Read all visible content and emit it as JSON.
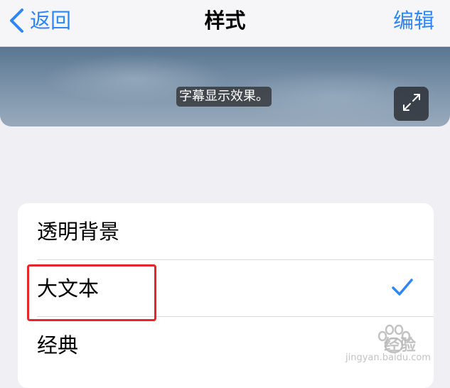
{
  "nav": {
    "back_label": "返回",
    "title": "样式",
    "edit_label": "编辑"
  },
  "preview": {
    "caption": "字幕显示效果。"
  },
  "styles": [
    {
      "label": "透明背景",
      "selected": false
    },
    {
      "label": "大文本",
      "selected": true
    },
    {
      "label": "经典",
      "selected": false
    }
  ],
  "watermark": {
    "text": "经验",
    "url": "jingyan.baidu.com"
  },
  "colors": {
    "accent": "#2f86f6",
    "highlight": "#e8252a",
    "background": "#efeff4"
  },
  "icons": {
    "back": "chevron-left-icon",
    "expand": "expand-icon",
    "check": "checkmark-icon"
  }
}
